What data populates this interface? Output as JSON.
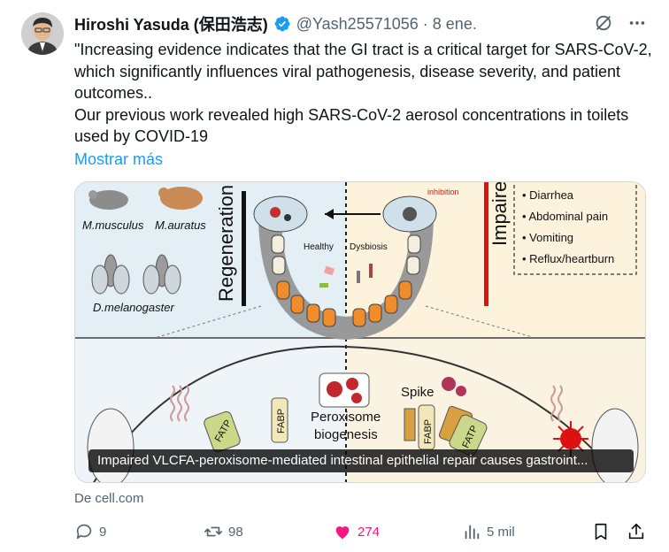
{
  "author": {
    "name": "Hiroshi Yasuda (保田浩志)",
    "handle": "@Yash25571056",
    "separator": "·",
    "date": "8 ene."
  },
  "tweet": {
    "lines": [
      "\"Increasing evidence indicates that the GI tract is a critical target for SARS-CoV-2, which significantly influences viral pathogenesis, disease severity, and patient outcomes..",
      "Our previous work revealed high SARS-CoV-2 aerosol concentrations in toilets used by COVID-19"
    ],
    "show_more": "Mostrar más"
  },
  "media": {
    "caption": "Impaired VLCFA-peroxisome-mediated intestinal epithelial repair causes gastroint...",
    "figure_text": {
      "regeneration": "Regeneration",
      "impaired_repair": "Impaired rep",
      "musculus": "M.musculus",
      "auratus": "M.auratus",
      "melanogaster": "D.melanogaster",
      "inhibition": "inhibition",
      "healthy": "Healthy",
      "dysbiosis": "Dysbiosis",
      "symptoms": [
        "Diarrhea",
        "Abdominal pain",
        "Vomiting",
        "Reflux/heartburn"
      ],
      "peroxisome": "Peroxisome",
      "biogenesis": "biogenesis",
      "spike": "Spike",
      "fatp": "FATP",
      "fabp": "FABP"
    }
  },
  "source": "De cell.com",
  "actions": {
    "replies": "9",
    "reposts": "98",
    "likes": "274",
    "views": "5 mil"
  },
  "colors": {
    "accent": "#1d9bf0",
    "like": "#f91880",
    "muted": "#536471"
  }
}
